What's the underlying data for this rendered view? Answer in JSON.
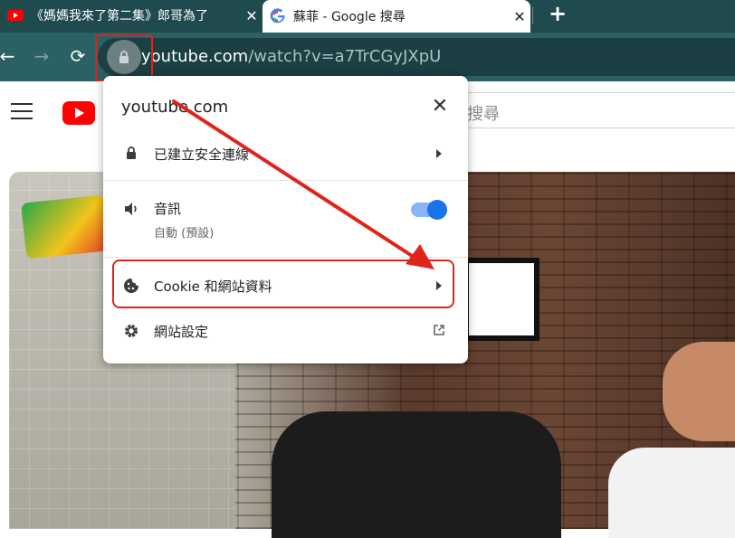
{
  "browser": {
    "tabs": [
      {
        "title": "《媽媽我來了第二集》郎哥為了",
        "favicon": "youtube-favicon"
      },
      {
        "title": "蘇菲 - Google 搜尋",
        "favicon": "google-favicon"
      }
    ],
    "close_glyph": "✕",
    "new_tab_glyph": "+",
    "nav": {
      "back": "←",
      "forward": "→",
      "reload": "⟳"
    },
    "url": {
      "host": "youtube.com",
      "path": "/watch?v=a7TrCGyJXpU"
    }
  },
  "youtube": {
    "search_placeholder": "搜尋"
  },
  "site_info_popup": {
    "site": "youtube.com",
    "close_glyph": "✕",
    "connection_label": "已建立安全連線",
    "sound": {
      "label": "音訊",
      "sublabel": "自動 (預設)",
      "enabled": true
    },
    "cookies_label": "Cookie 和網站資料",
    "site_settings_label": "網站設定"
  },
  "colors": {
    "tab_strip": "#1f4a4e",
    "toolbar": "#2b6064",
    "highlight_red": "#e0241c",
    "toggle_blue": "#1a73e8"
  }
}
